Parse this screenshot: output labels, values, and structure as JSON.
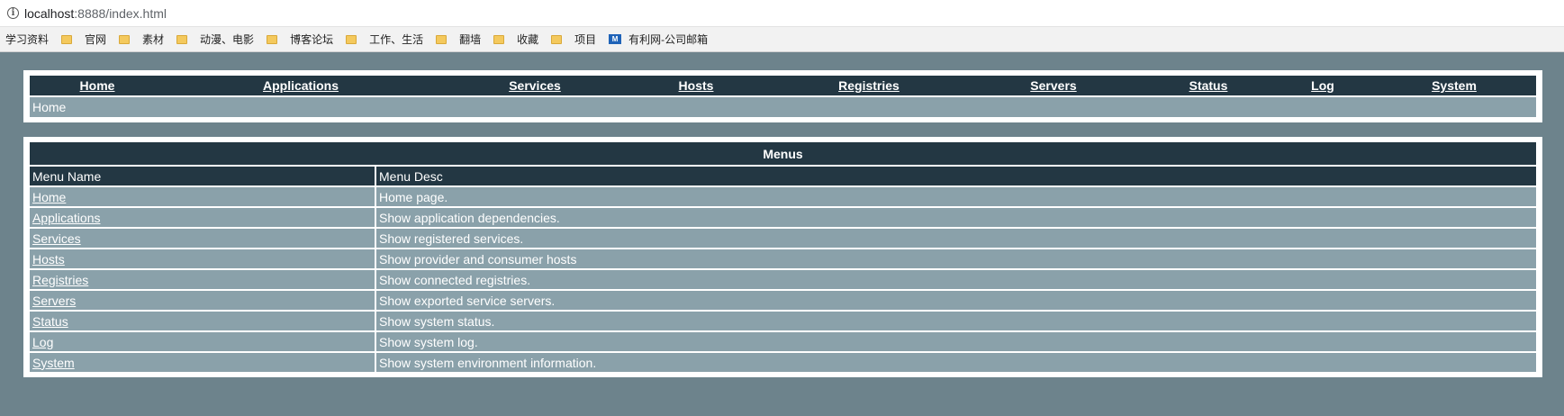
{
  "browser": {
    "url_host": "localhost",
    "url_rest": ":8888/index.html",
    "bookmarks": [
      {
        "label": "学习资料",
        "icon": "none"
      },
      {
        "label": "官网",
        "icon": "folder-icon"
      },
      {
        "label": "素材",
        "icon": "folder-icon"
      },
      {
        "label": "动漫、电影",
        "icon": "folder-icon"
      },
      {
        "label": "博客论坛",
        "icon": "folder-icon"
      },
      {
        "label": "工作、生活",
        "icon": "folder-icon"
      },
      {
        "label": "翻墙",
        "icon": "folder-icon"
      },
      {
        "label": "收藏",
        "icon": "folder-icon"
      },
      {
        "label": "项目",
        "icon": "folder-icon"
      },
      {
        "label": "有利网-公司邮箱",
        "icon": "mail-icon"
      }
    ]
  },
  "nav": {
    "items": [
      "Home",
      "Applications",
      "Services",
      "Hosts",
      "Registries",
      "Servers",
      "Status",
      "Log",
      "System"
    ],
    "breadcrumb": "Home"
  },
  "menus": {
    "title": "Menus",
    "columns": [
      "Menu Name",
      "Menu Desc"
    ],
    "rows": [
      {
        "name": "Home",
        "desc": "Home page."
      },
      {
        "name": "Applications",
        "desc": "Show application dependencies."
      },
      {
        "name": "Services",
        "desc": "Show registered services."
      },
      {
        "name": "Hosts",
        "desc": "Show provider and consumer hosts"
      },
      {
        "name": "Registries",
        "desc": "Show connected registries."
      },
      {
        "name": "Servers",
        "desc": "Show exported service servers."
      },
      {
        "name": "Status",
        "desc": "Show system status."
      },
      {
        "name": "Log",
        "desc": "Show system log."
      },
      {
        "name": "System",
        "desc": "Show system environment information."
      }
    ]
  },
  "colors": {
    "background": "#6d838c",
    "header_dark": "#233743",
    "row_light": "#8aa1aa"
  }
}
